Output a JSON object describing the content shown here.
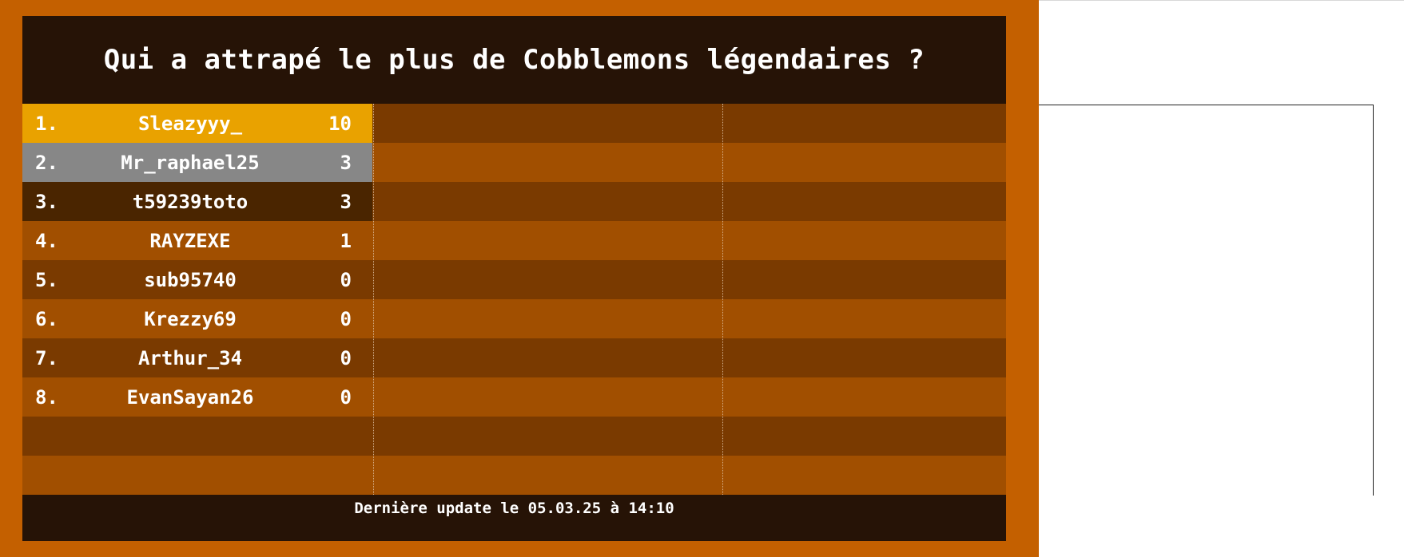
{
  "leaderboard": {
    "title": "Qui a attrapé le plus de Cobblemons légendaires ?",
    "entries": [
      {
        "rank": "1.",
        "name": "Sleazyyy_",
        "score": "10"
      },
      {
        "rank": "2.",
        "name": "Mr_raphael25",
        "score": "3"
      },
      {
        "rank": "3.",
        "name": "t59239toto",
        "score": "3"
      },
      {
        "rank": "4.",
        "name": "RAYZEXE",
        "score": "1"
      },
      {
        "rank": "5.",
        "name": "sub95740",
        "score": "0"
      },
      {
        "rank": "6.",
        "name": "Krezzy69",
        "score": "0"
      },
      {
        "rank": "7.",
        "name": "Arthur_34",
        "score": "0"
      },
      {
        "rank": "8.",
        "name": "EvanSayan26",
        "score": "0"
      }
    ],
    "footer": "Dernière update le 05.03.25 à 14:10"
  },
  "colors": {
    "frame": "#c46000",
    "header_bg": "#261306",
    "row_dark": "#7a3a00",
    "row_light": "#a14f00",
    "gold": "#e9a200",
    "silver": "#878787",
    "bronze": "#4a2500"
  }
}
